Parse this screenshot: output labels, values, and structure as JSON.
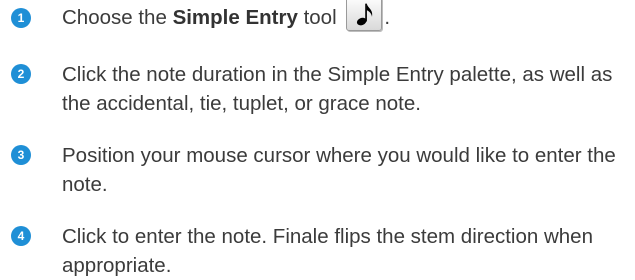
{
  "steps": [
    {
      "number": "1",
      "text_before": "Choose the ",
      "bold": "Simple Entry",
      "text_after_bold": " tool",
      "icon": "eighth-note-icon",
      "text_end": "."
    },
    {
      "number": "2",
      "text": "Click the note duration in the Simple Entry palette, as well as the accidental, tie, tuplet, or grace note."
    },
    {
      "number": "3",
      "text": "Position your mouse cursor where you would like to enter the note."
    },
    {
      "number": "4",
      "text": "Click to enter the note. Finale flips the stem direction when appropriate."
    }
  ],
  "colors": {
    "badge": "#1f8fd6",
    "text": "#3b3b3b"
  }
}
